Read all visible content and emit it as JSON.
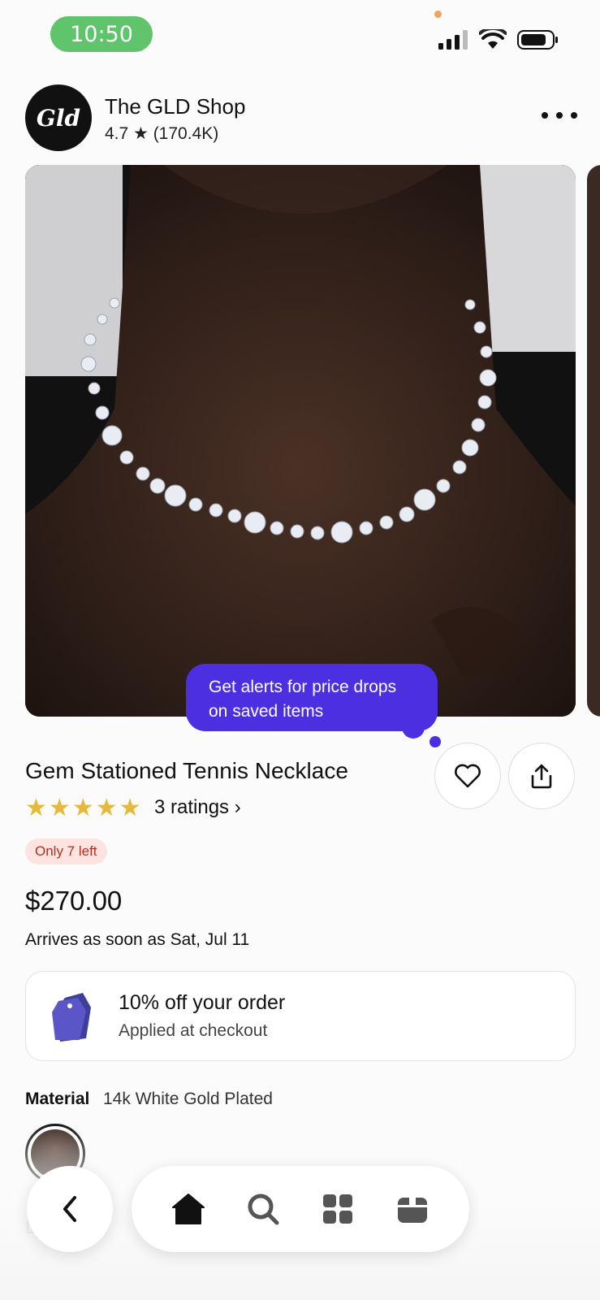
{
  "status_bar": {
    "time": "10:50"
  },
  "shop": {
    "logo_text": "Gld",
    "name": "The GLD Shop",
    "rating": "4.7 ★ (170.4K)"
  },
  "tooltip": {
    "text_line1": "Get alerts for price drops",
    "text_line2": "on saved items"
  },
  "product": {
    "title": "Gem Stationed Tennis Necklace",
    "star_count": 5,
    "ratings_link": "3 ratings ›",
    "stock_badge": "Only 7 left",
    "price": "$270.00",
    "arrival": "Arrives as soon as Sat, Jul 11"
  },
  "promo": {
    "title": "10% off your order",
    "subtitle": "Applied at checkout"
  },
  "material": {
    "label": "Material",
    "value": "14k White Gold Plated"
  },
  "length": {
    "label": "L"
  },
  "nav": {
    "items": [
      "home-icon",
      "search-icon",
      "categories-icon",
      "orders-icon"
    ]
  },
  "colors": {
    "accent": "#4b2fe0",
    "star": "#e7b93a",
    "status_pill": "#5fc46c",
    "badge_bg": "#fde4e0",
    "badge_text": "#b0321f"
  }
}
